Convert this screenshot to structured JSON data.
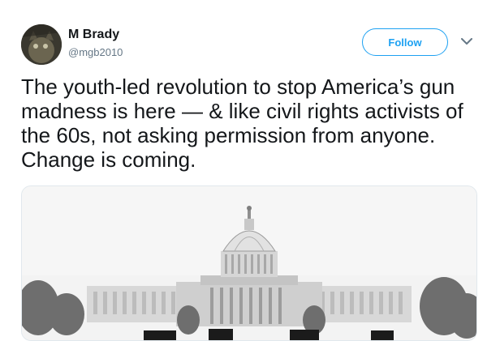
{
  "tweet": {
    "author": {
      "name": "M Brady",
      "handle": "@mgb2010",
      "avatar_icon": "avatar-photo"
    },
    "follow_label": "Follow",
    "menu_icon": "chevron-down-icon",
    "text": "The youth-led revolution to stop America’s gun madness is here — & like civil rights activists of the 60s, not asking permission from anyone. Change is coming.",
    "media": {
      "description_icon": "capitol-building-illustration"
    }
  },
  "colors": {
    "accent": "#1da1f2",
    "secondary_text": "#657786",
    "primary_text": "#14171a"
  }
}
